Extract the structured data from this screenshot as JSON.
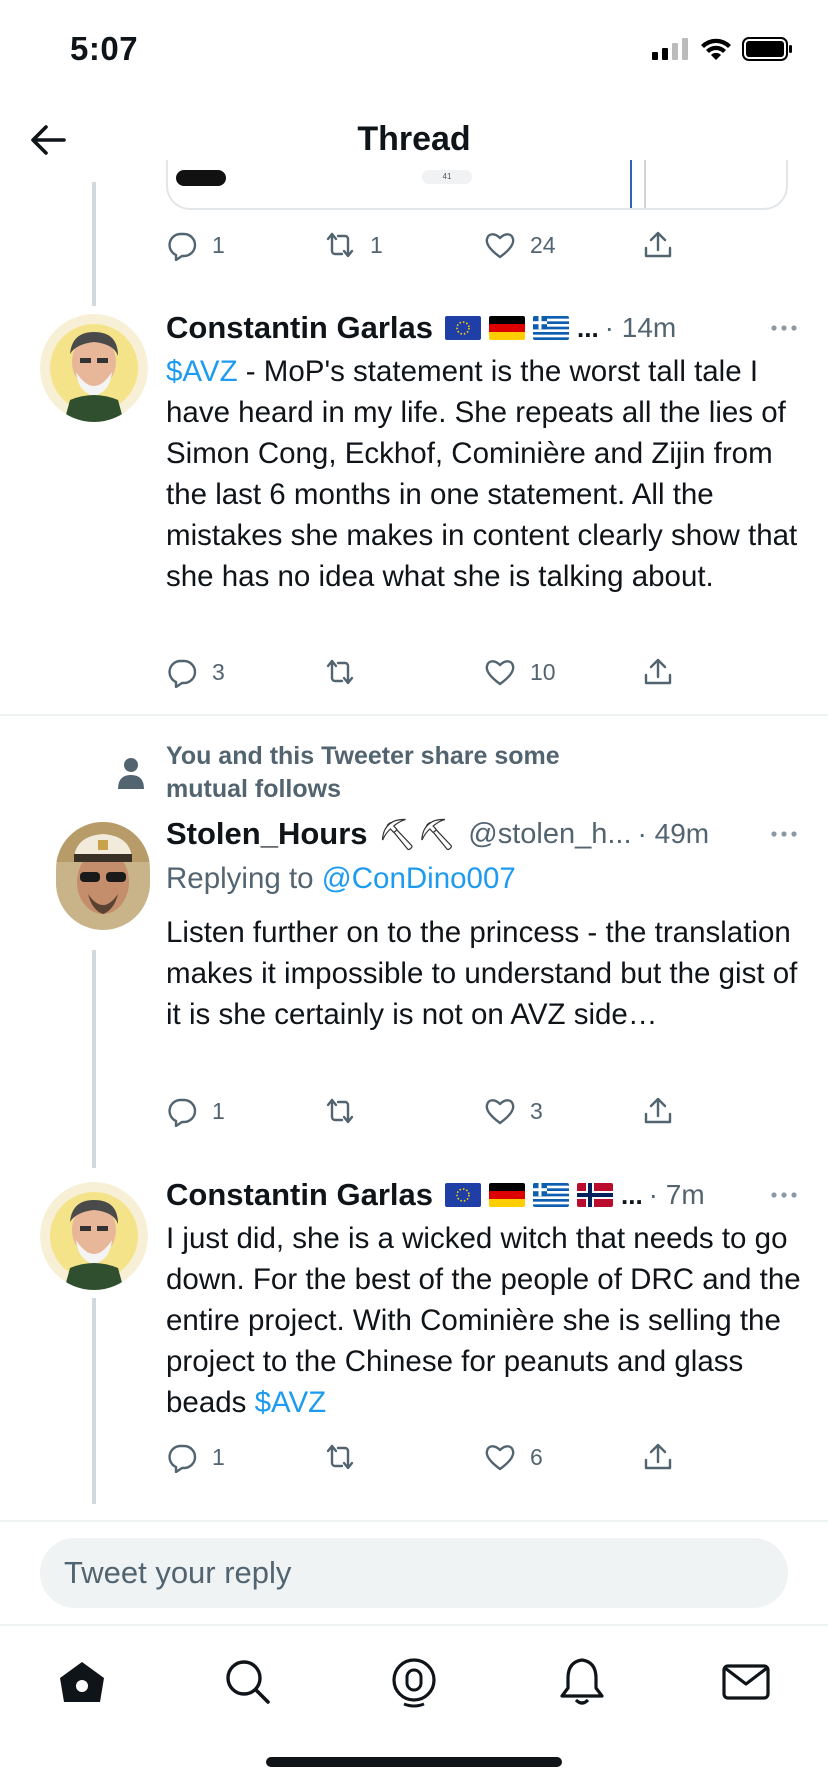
{
  "status_bar": {
    "time": "5:07"
  },
  "header": {
    "title": "Thread"
  },
  "embed": {
    "chip_text": "41"
  },
  "prev_tweet": {
    "replies": "1",
    "retweets": "1",
    "likes": "24"
  },
  "tweet1": {
    "name": "Constantin Garlas",
    "flags": [
      "EU",
      "DE",
      "GR"
    ],
    "ellipsis": "...",
    "time": "· 14m",
    "cashtag": "$AVZ",
    "text": " - MoP's statement is the worst tall tale I have heard in my life. She repeats all the lies of Simon Cong, Eckhof, Cominière and Zijin from the last 6 months in one statement. All the mistakes she makes in content clearly show that she has no idea what she is talking about.",
    "replies": "3",
    "retweets": "",
    "likes": "10"
  },
  "social_context": "You and this Tweeter share some mutual follows",
  "tweet2": {
    "name": "Stolen_Hours",
    "emoji": "⛏⛏",
    "handle": "@stolen_h...",
    "time": "· 49m",
    "replying_prefix": "Replying to ",
    "replying_handle": "@ConDino007",
    "text": "Listen further on to the princess - the translation makes it impossible to understand but the gist of it is she certainly is not on AVZ side…",
    "replies": "1",
    "retweets": "",
    "likes": "3"
  },
  "tweet3": {
    "name": "Constantin Garlas",
    "flags": [
      "EU",
      "DE",
      "GR",
      "NO"
    ],
    "ellipsis": "...",
    "time": "· 7m",
    "text": "I just did, she is a wicked witch that needs to go down. For the best of the people of DRC and the entire project. With Cominière she is selling the project to the Chinese for peanuts and glass beads ",
    "cashtag": "$AVZ",
    "replies": "1",
    "retweets": "",
    "likes": "6"
  },
  "reply_box": {
    "placeholder": "Tweet your reply"
  },
  "tab_bar": {
    "items": [
      {
        "name": "home",
        "icon": "home-icon"
      },
      {
        "name": "search",
        "icon": "search-icon"
      },
      {
        "name": "spaces",
        "icon": "spaces-icon"
      },
      {
        "name": "notifications",
        "icon": "bell-icon"
      },
      {
        "name": "messages",
        "icon": "mail-icon"
      }
    ]
  },
  "colors": {
    "link": "#1d9bf0",
    "secondary_text": "#536471",
    "thread_line": "#cfd9de"
  }
}
